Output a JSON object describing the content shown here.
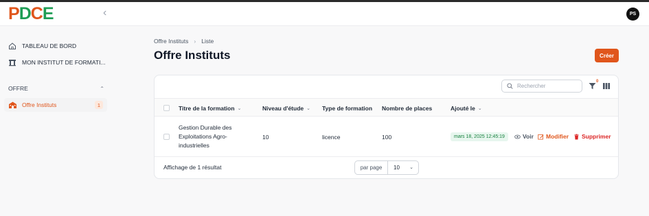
{
  "app": {
    "logo": [
      "P",
      "D",
      "C",
      "E"
    ],
    "logo_colors": [
      "#e0561c",
      "#1f9d55",
      "#e0561c",
      "#1f9d55"
    ],
    "user_initials": "PS"
  },
  "sidebar": {
    "items": [
      {
        "label": "TABLEAU DE BORD",
        "icon": "home-icon"
      },
      {
        "label": "MON INSTITUT DE FORMATI...",
        "icon": "building-icon"
      }
    ],
    "section_label": "OFFRE",
    "active_item": {
      "label": "Offre Instituts",
      "count": "1",
      "icon": "school-icon"
    }
  },
  "breadcrumb": [
    "Offre Instituts",
    "Liste"
  ],
  "page_title": "Offre Instituts",
  "create_label": "Créer",
  "table": {
    "search_placeholder": "Rechercher",
    "filter_count": "0",
    "columns": [
      "Titre de la formation",
      "Niveau d'étude",
      "Type de formation",
      "Nombre de places",
      "Ajouté le"
    ],
    "rows": [
      {
        "title": "Gestion Durable des Exploitations Agro-industrielles",
        "niveau": "10",
        "type": "licence",
        "places": "100",
        "date": "mars 18, 2025 12:45:19",
        "actions": {
          "view": "Voir",
          "edit": "Modifier",
          "delete": "Supprimer"
        }
      }
    ],
    "footer": "Affichage de 1 résultat",
    "per_page_label": "par page",
    "per_page_value": "10"
  },
  "colors": {
    "accent": "#e0561c",
    "success": "#15803d",
    "danger": "#dc2626"
  }
}
